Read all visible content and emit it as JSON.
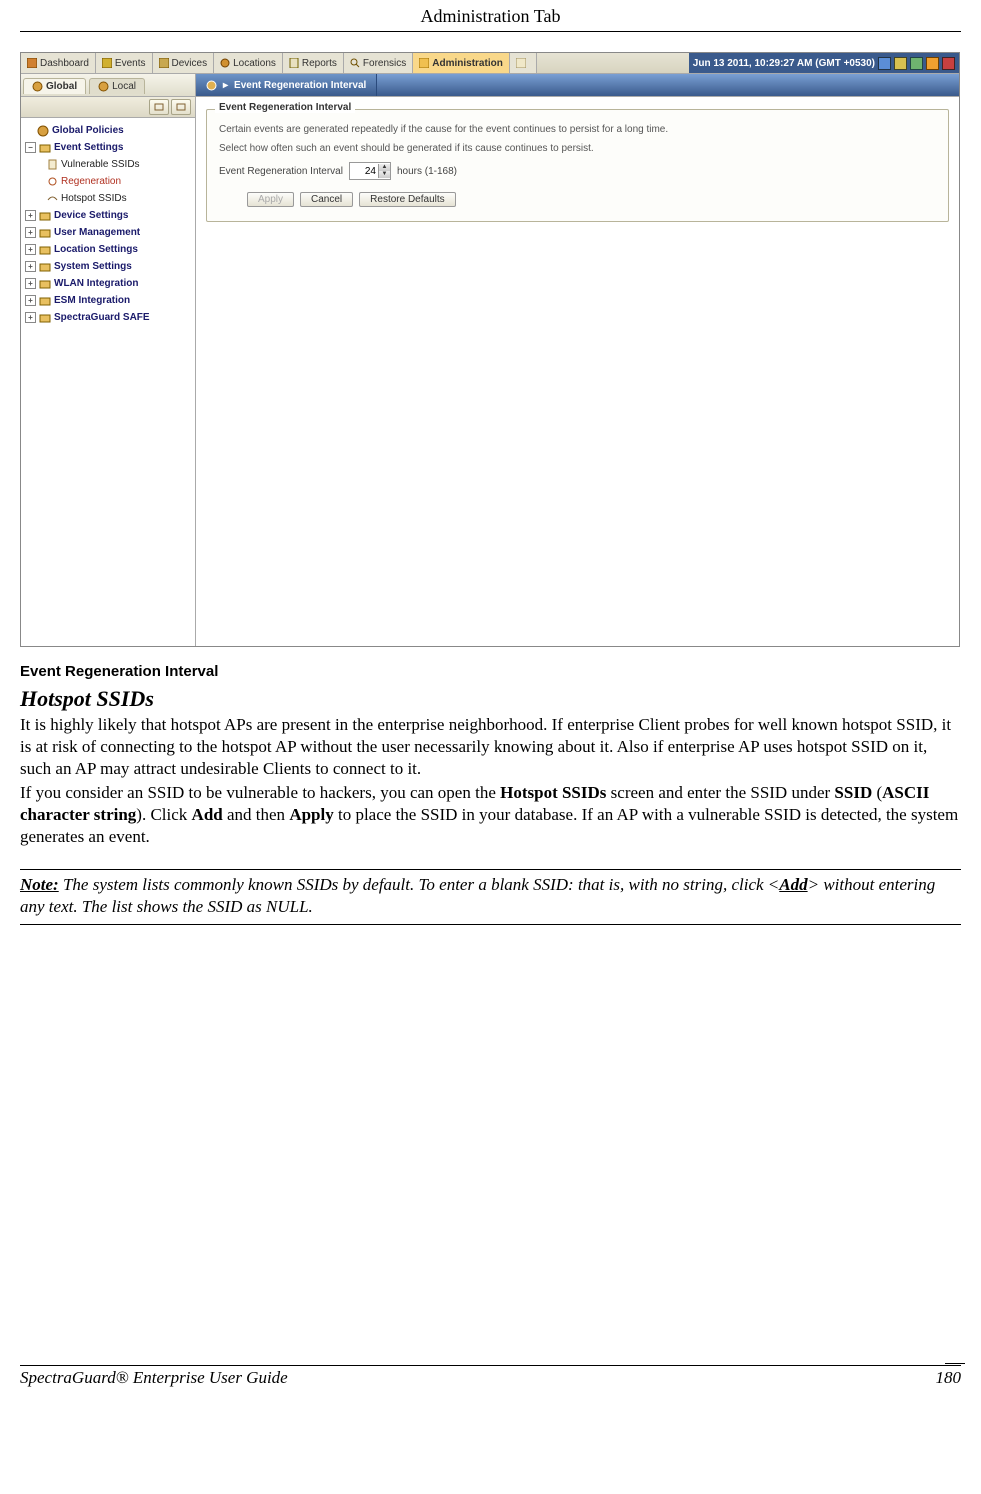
{
  "header": {
    "title": "Administration Tab"
  },
  "screenshot": {
    "topTabs": {
      "items": [
        {
          "label": "Dashboard"
        },
        {
          "label": "Events"
        },
        {
          "label": "Devices"
        },
        {
          "label": "Locations"
        },
        {
          "label": "Reports"
        },
        {
          "label": "Forensics"
        },
        {
          "label": "Administration"
        }
      ],
      "timestamp": "Jun 13 2011, 10:29:27 AM (GMT +0530)"
    },
    "scopeTabs": {
      "global": "Global",
      "local": "Local"
    },
    "breadcrumb": {
      "segment": "Event Regeneration Interval"
    },
    "sidebar": {
      "root": "Global Policies",
      "eventSettings": {
        "label": "Event Settings",
        "children": [
          {
            "label": "Vulnerable SSIDs"
          },
          {
            "label": "Regeneration"
          },
          {
            "label": "Hotspot SSIDs"
          }
        ]
      },
      "others": [
        {
          "label": "Device Settings"
        },
        {
          "label": "User Management"
        },
        {
          "label": "Location Settings"
        },
        {
          "label": "System Settings"
        },
        {
          "label": "WLAN Integration"
        },
        {
          "label": "ESM Integration"
        },
        {
          "label": "SpectraGuard SAFE"
        }
      ]
    },
    "panel": {
      "legend": "Event Regeneration Interval",
      "line1": "Certain events are generated repeatedly if the cause for the event continues to persist for a long time.",
      "line2": "Select how often such an event should be generated if its cause continues to persist.",
      "fieldLabel": "Event Regeneration Interval",
      "fieldValue": "24",
      "fieldUnits": "hours (1-168)",
      "buttons": {
        "apply": "Apply",
        "cancel": "Cancel",
        "restore": "Restore Defaults"
      }
    }
  },
  "doc": {
    "caption": "Event Regeneration Interval",
    "sectionTitle": "Hotspot SSIDs",
    "para1a": "It is highly likely that hotspot APs are present in the enterprise neighborhood. If enterprise Client probes for well known hotspot SSID, it is at risk of connecting to the hotspot AP without the user necessarily knowing about it. Also if enterprise AP uses hotspot SSID on it, such an AP may attract undesirable Clients to connect to it.",
    "para2_pre": "If you consider an SSID to be vulnerable to hackers, you can open the ",
    "para2_b1": "Hotspot SSIDs",
    "para2_mid1": " screen and enter the SSID under ",
    "para2_b2": "SSID",
    "para2_paren_open": " (",
    "para2_b3": "ASCII character string",
    "para2_paren_close": "). Click ",
    "para2_b4": "Add",
    "para2_mid2": " and then ",
    "para2_b5": "Apply",
    "para2_end": " to place the SSID in your database. If an AP with a vulnerable SSID is detected, the system generates an event.",
    "note_label": "Note:",
    "note_pre": " The system lists commonly known SSIDs by default. To enter a blank SSID: that is, with no string, click <",
    "note_add": "Add",
    "note_post": "> without entering any text. The list shows the SSID as NULL."
  },
  "footer": {
    "left": "SpectraGuard® Enterprise User Guide",
    "right": "180"
  }
}
